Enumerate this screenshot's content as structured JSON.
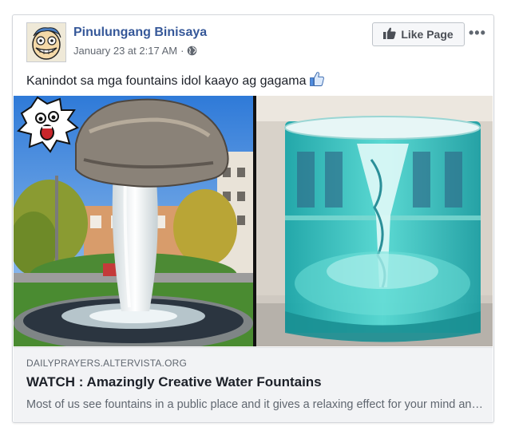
{
  "post": {
    "page_name": "Pinulungang Binisaya",
    "timestamp": "January 23 at 2:17 AM",
    "separator": "·",
    "privacy_icon": "globe-icon",
    "like_button": "Like Page",
    "like_icon": "thumbs-up-icon",
    "more_label": "•••",
    "text": "Kanindot sa mga fountains idol kaayo ag gagama",
    "text_emoji": "thumbs-up-emoji"
  },
  "media": {
    "left_image": "floating-rock-fountain",
    "right_image": "glass-vortex-fountain",
    "sticker": "screaming-face-sticker"
  },
  "link": {
    "domain": "DAILYPRAYERS.ALTERVISTA.ORG",
    "title": "WATCH : Amazingly Creative Water Fountains",
    "description": "Most of us see fountains in a public place and it gives a relaxing effect for your mind and body."
  },
  "colors": {
    "link_blue": "#365899",
    "text_dark": "#1d2129",
    "text_gray": "#606770",
    "link_bg": "#f2f3f5",
    "border": "#dddfe2"
  }
}
